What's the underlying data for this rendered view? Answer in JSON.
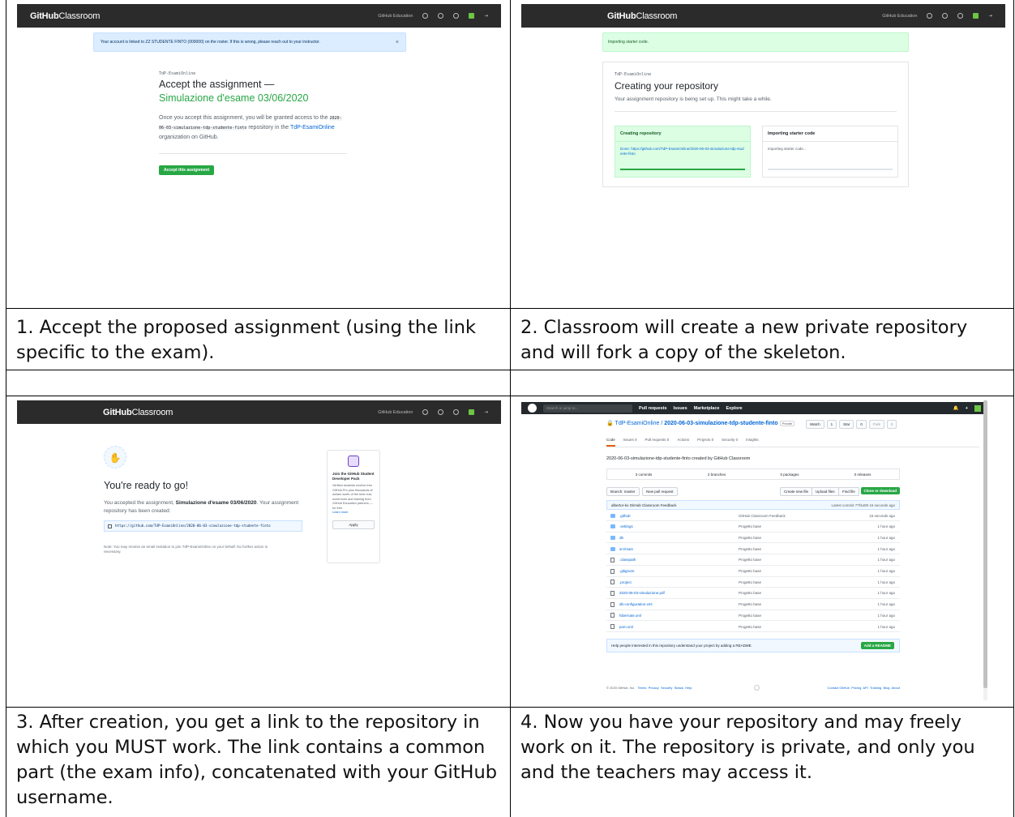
{
  "captions": {
    "c1": "1. Accept the proposed assignment (using the link specific to the exam).",
    "c2": "2. Classroom will create a new private repository and will fork a copy of the skeleton.",
    "c3": "3. After creation, you get a link to the repository in which you MUST work. The link contains a common part (the exam info), concatenated with your GitHub username.",
    "c4": "4. Now you have your repository and may freely work on it. The repository is private, and only you and the teachers may access it."
  },
  "classroom": {
    "logo_bold": "GitHub",
    "logo_light": "Classroom",
    "nav_link": "GitHub Education"
  },
  "panel1": {
    "flash": "Your account is linked to ZZ STUDENTE FINTO (000000) on the roster. If this is wrong, please reach out to your instructor.",
    "org": "TdP-EsamiOnline",
    "heading": "Accept the assignment —",
    "assignment": "Simulazione d'esame 03/06/2020",
    "desc_a": "Once you accept this assignment, you will be granted access to the",
    "repo_code": "2020-06-03-simulazione-tdp-studente-finto",
    "desc_b": "repository in the",
    "org_link": "TdP-EsamiOnline",
    "desc_c": "organization on GitHub.",
    "button": "Accept this assignment"
  },
  "panel2": {
    "flash": "Importing starter code.",
    "org": "TdP-EsamiOnline",
    "heading": "Creating your repository",
    "sub": "Your assignment repository is being set up. This might take a while.",
    "step1_title": "Creating repository",
    "step1_body": "Done: https://github.com/TdP-EsamiOnline/2020-06-03-simulazione-tdp-studente-finto",
    "step1_progress": 1.0,
    "step2_title": "Importing starter code",
    "step2_body": "Importing starter code...",
    "step2_progress": 0.0
  },
  "panel3": {
    "heading": "You're ready to go!",
    "accepted_a": "You accepted the assignment,",
    "accepted_b": "Simulazione d'esame 03/06/2020",
    "accepted_c": ". Your assignment repository has been created:",
    "repo_url": "https://github.com/TdP-EsamiOnline/2020-06-03-simulazione-tdp-studente-finto",
    "note": "Note: You may receive an email invitation to join TdP-EsamiOnline on your behalf. No further action is necessary.",
    "pack_title": "Join the GitHub Student Developer Pack",
    "pack_body": "Verified students receive free GitHub Pro plus thousands of dollars worth of the best real-world tools and training from GitHub Education partners — for free.",
    "pack_link": "Learn more",
    "apply": "Apply"
  },
  "panel4": {
    "search_placeholder": "Search or jump to...",
    "nav": [
      "Pull requests",
      "Issues",
      "Marketplace",
      "Explore"
    ],
    "repo_owner": "TdP-EsamiOnline",
    "repo_name": "2020-06-03-simulazione-tdp-studente-finto",
    "private_badge": "Private",
    "watch": "Watch",
    "watch_count": "1",
    "star": "Star",
    "star_count": "0",
    "fork": "Fork",
    "fork_count": "0",
    "tabs": [
      "Code",
      "Issues 0",
      "Pull requests 0",
      "Actions",
      "Projects 0",
      "Security 0",
      "Insights"
    ],
    "description": "2020-06-03-simulazione-tdp-studente-finto created by GitHub Classroom",
    "stats": [
      "3 commits",
      "2 branches",
      "0 packages",
      "0 releases"
    ],
    "branch": "Branch: master",
    "new_pr": "New pull request",
    "create_file": "Create new file",
    "upload": "Upload files",
    "find": "Find file",
    "clone": "Clone or download",
    "commit_msg": "albertor-ko  GitHub Classroom Feedback",
    "latest": "Latest commit 77f4a09 16 seconds ago",
    "files": [
      {
        "name": ".github",
        "type": "folder",
        "msg": "GitHub Classroom Feedback",
        "ago": "16 seconds ago"
      },
      {
        "name": ".settings",
        "type": "folder",
        "msg": "Progetto base",
        "ago": "1 hour ago"
      },
      {
        "name": "db",
        "type": "folder",
        "msg": "Progetto base",
        "ago": "1 hour ago"
      },
      {
        "name": "src/main",
        "type": "folder",
        "msg": "Progetto base",
        "ago": "1 hour ago"
      },
      {
        "name": ".classpath",
        "type": "file",
        "msg": "Progetto base",
        "ago": "1 hour ago"
      },
      {
        "name": ".gitignore",
        "type": "file",
        "msg": "Progetto base",
        "ago": "1 hour ago"
      },
      {
        "name": ".project",
        "type": "file",
        "msg": "Progetto base",
        "ago": "1 hour ago"
      },
      {
        "name": "2020-06-03-simulazione.pdf",
        "type": "file",
        "msg": "Progetto base",
        "ago": "1 hour ago"
      },
      {
        "name": "db-configuration.xml",
        "type": "file",
        "msg": "Progetto base",
        "ago": "1 hour ago"
      },
      {
        "name": "hibernate.xml",
        "type": "file",
        "msg": "Progetto base",
        "ago": "1 hour ago"
      },
      {
        "name": "pom.xml",
        "type": "file",
        "msg": "Progetto base",
        "ago": "1 hour ago"
      }
    ],
    "readme_hint": "Help people interested in this repository understand your project by adding a README.",
    "add_readme": "Add a README",
    "footer_left": [
      "© 2020 GitHub, Inc.",
      "Terms",
      "Privacy",
      "Security",
      "Status",
      "Help"
    ],
    "footer_right": [
      "Contact GitHub",
      "Pricing",
      "API",
      "Training",
      "Blog",
      "About"
    ]
  }
}
